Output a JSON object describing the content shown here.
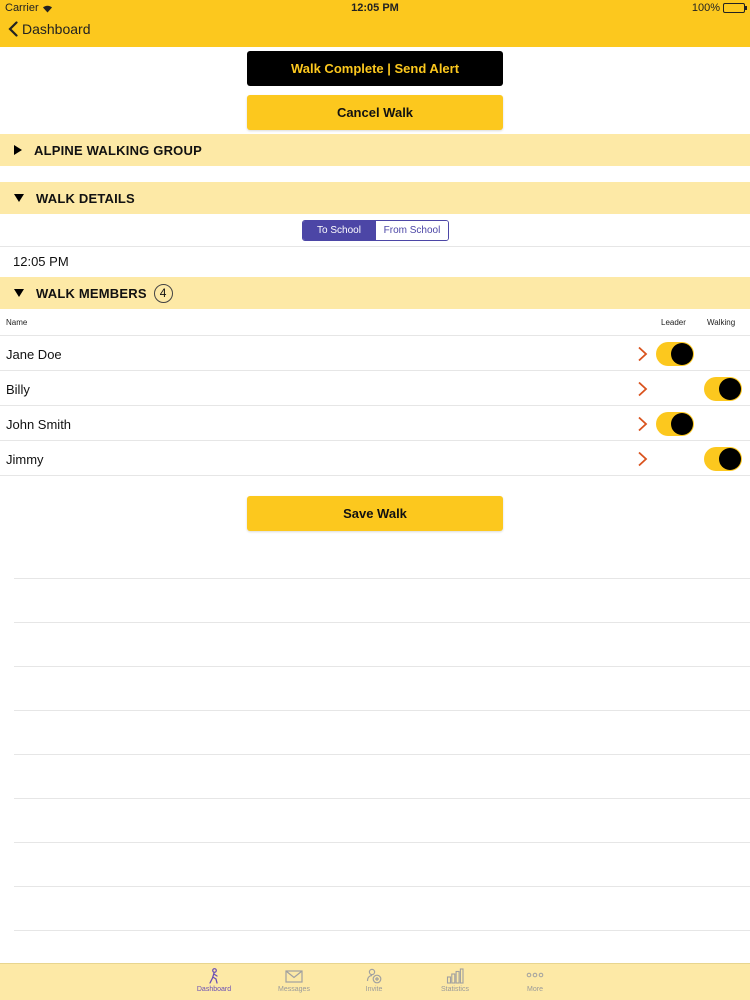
{
  "status_bar": {
    "carrier": "Carrier",
    "time": "12:05 PM",
    "battery": "100%"
  },
  "nav": {
    "back_label": "Dashboard"
  },
  "actions": {
    "walk_complete_label": "Walk Complete | Send Alert",
    "cancel_label": "Cancel Walk",
    "save_label": "Save Walk"
  },
  "sections": {
    "group": "ALPINE WALKING GROUP",
    "details": "WALK DETAILS",
    "members": "WALK MEMBERS"
  },
  "walk_details": {
    "direction_options": [
      "To School",
      "From School"
    ],
    "selected_direction": "To School",
    "time": "12:05 PM"
  },
  "members": {
    "count": "4",
    "columns": {
      "name": "Name",
      "leader": "Leader",
      "walking": "Walking"
    },
    "rows": [
      {
        "name": "Jane Doe",
        "leader": true,
        "walking": false
      },
      {
        "name": "Billy",
        "leader": false,
        "walking": true
      },
      {
        "name": "John Smith",
        "leader": true,
        "walking": false
      },
      {
        "name": "Jimmy",
        "leader": false,
        "walking": true
      }
    ]
  },
  "tabbar": {
    "items": [
      {
        "label": "Dashboard",
        "icon": "walker-icon",
        "active": true
      },
      {
        "label": "Messages",
        "icon": "envelope-icon",
        "active": false
      },
      {
        "label": "Invite",
        "icon": "invite-person-icon",
        "active": false
      },
      {
        "label": "Statistics",
        "icon": "bar-chart-icon",
        "active": false
      },
      {
        "label": "More",
        "icon": "more-dots-icon",
        "active": false
      }
    ]
  },
  "colors": {
    "brand_yellow": "#fcc81e",
    "section_yellow": "#fde9a6",
    "accent_purple": "#4c46a6",
    "chevron_red": "#d9531e"
  }
}
